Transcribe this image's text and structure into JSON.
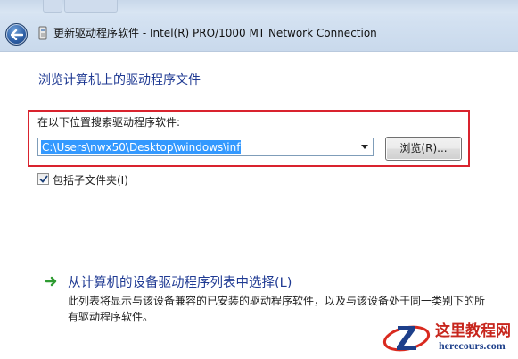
{
  "window": {
    "title": "更新驱动程序软件 - Intel(R) PRO/1000 MT Network Connection"
  },
  "page": {
    "heading": "浏览计算机上的驱动程序文件",
    "search_label": "在以下位置搜索驱动程序软件:",
    "path_value": "C:\\Users\\nwx50\\Desktop\\windows\\inf",
    "browse_label": "浏览(R)...",
    "include_subfolders_label": "包括子文件夹(I)",
    "include_subfolders_checked": true
  },
  "pick_option": {
    "title": "从计算机的设备驱动程序列表中选择(L)",
    "description": "此列表将显示与该设备兼容的已安装的驱动程序软件，以及与该设备处于同一类别下的所有驱动程序软件。"
  },
  "watermark": {
    "name": "这里教程网",
    "url": "herecours.com"
  },
  "colors": {
    "heading_blue": "#1f3a93",
    "highlight_red": "#d9232e",
    "selection_blue": "#3399ff",
    "arrow_green": "#2e9b31"
  },
  "icons": [
    "back-arrow-icon",
    "driver-device-icon",
    "dropdown-arrow-icon",
    "checkmark-icon",
    "green-arrow-icon"
  ]
}
